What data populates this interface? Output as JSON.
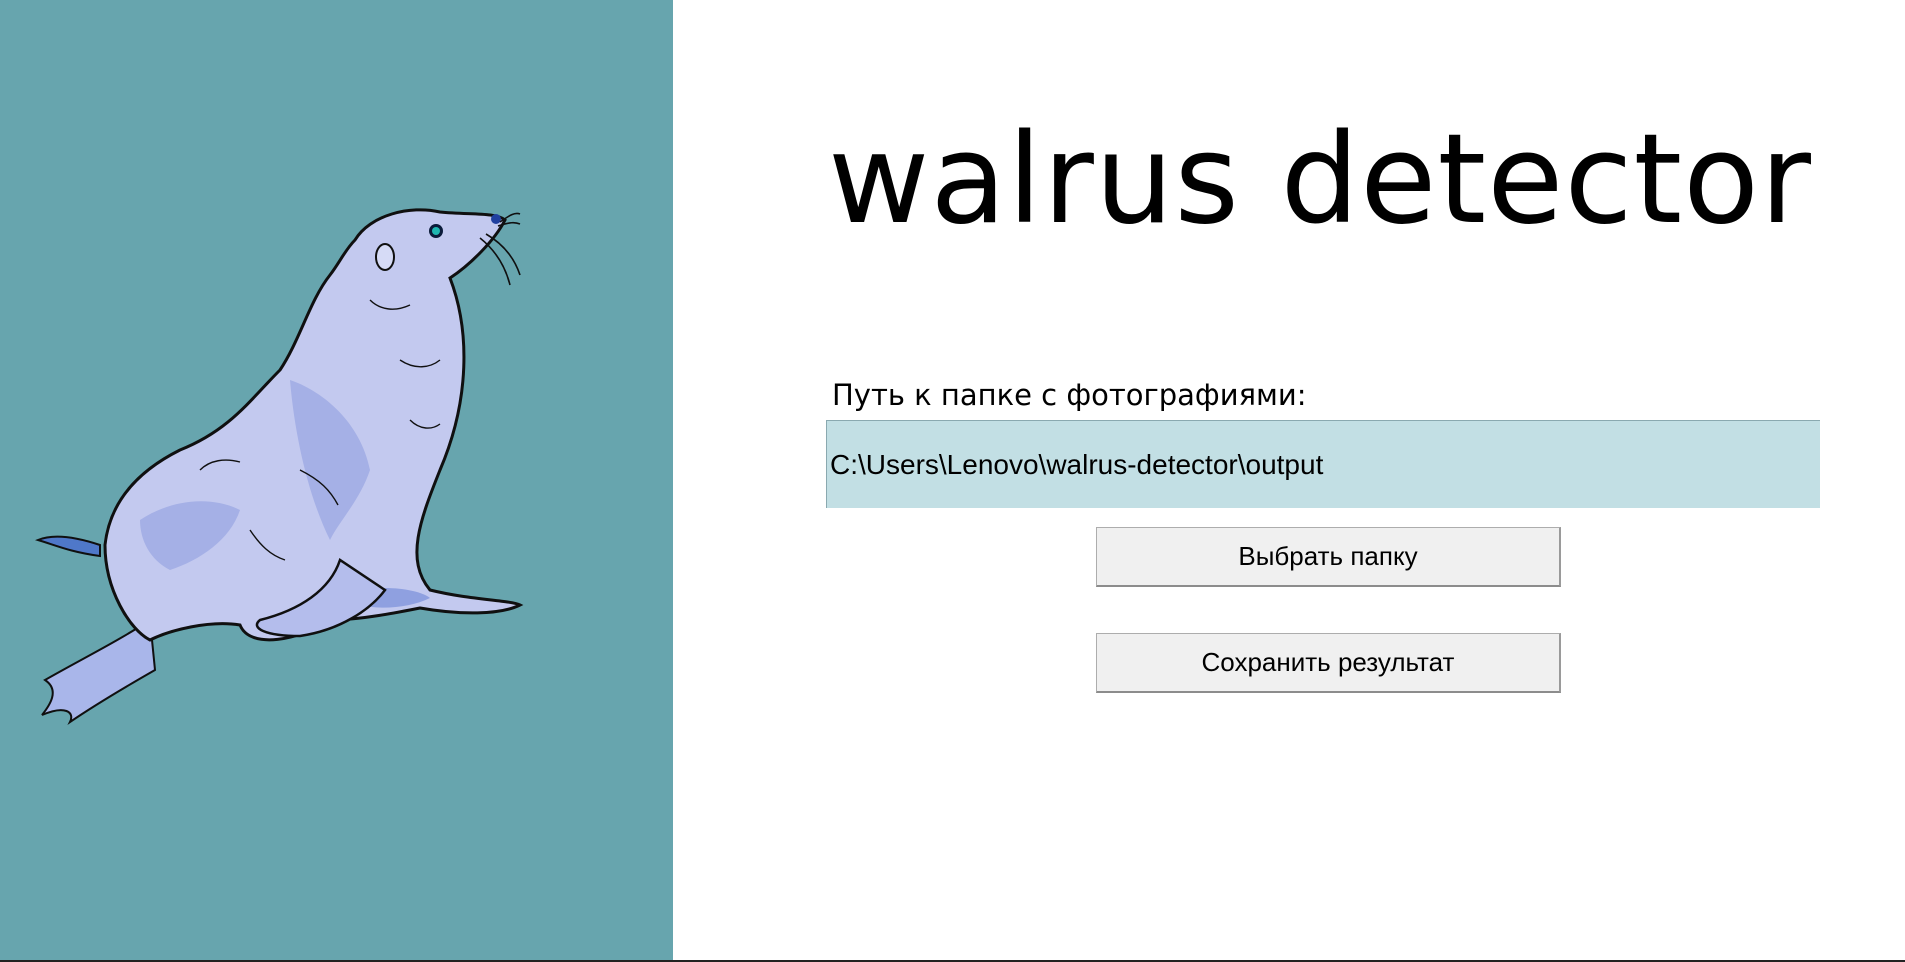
{
  "app": {
    "title": "walrus detector"
  },
  "form": {
    "path_label": "Путь к папке с фотографиями:",
    "path_value": "C:\\Users\\Lenovo\\walrus-detector\\output"
  },
  "buttons": {
    "choose_folder": "Выбрать папку",
    "save_result": "Сохранить результат"
  },
  "illustration": {
    "icon": "walrus-illustration",
    "panel_color": "#67a5ae",
    "body_color": "#c3c9ef"
  }
}
